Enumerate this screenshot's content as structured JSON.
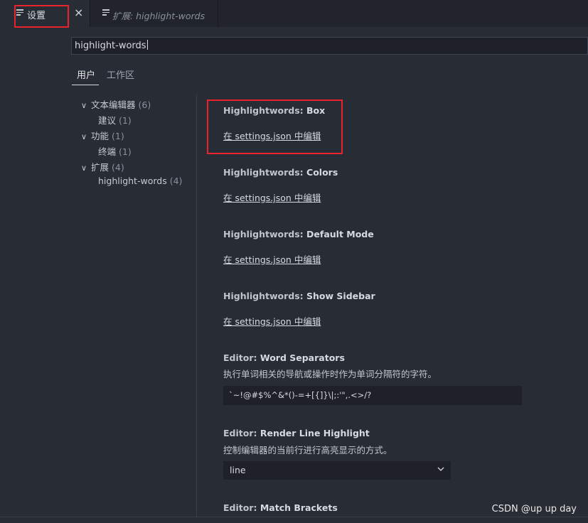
{
  "tabs": [
    {
      "label": "设置",
      "close": "×"
    },
    {
      "label": "扩展: highlight-words"
    }
  ],
  "search": {
    "value": "highlight-words"
  },
  "scopes": {
    "user": "用户",
    "workspace": "工作区"
  },
  "toc": [
    {
      "label": "文本编辑器",
      "count": "(6)",
      "chevron": "∨"
    },
    {
      "label": "建议",
      "count": "(1)"
    },
    {
      "label": "功能",
      "count": "(1)",
      "chevron": "∨"
    },
    {
      "label": "终端",
      "count": "(1)"
    },
    {
      "label": "扩展",
      "count": "(4)",
      "chevron": "∨"
    },
    {
      "label": "highlight-words",
      "count": "(4)"
    }
  ],
  "settings": [
    {
      "category": "Highlightwords: ",
      "name": "Box",
      "link": "在 settings.json 中编辑"
    },
    {
      "category": "Highlightwords: ",
      "name": "Colors",
      "link": "在 settings.json 中编辑"
    },
    {
      "category": "Highlightwords: ",
      "name": "Default Mode",
      "link": "在 settings.json 中编辑"
    },
    {
      "category": "Highlightwords: ",
      "name": "Show Sidebar",
      "link": "在 settings.json 中编辑"
    },
    {
      "category": "Editor: ",
      "name": "Word Separators",
      "description": "执行单词相关的导航或操作时作为单词分隔符的字符。",
      "value": "`~!@#$%^&*()-=+[{]}\\|;:'\",.<>/?"
    },
    {
      "category": "Editor: ",
      "name": "Render Line Highlight",
      "description": "控制编辑器的当前行进行高亮显示的方式。",
      "value": "line"
    },
    {
      "category": "Editor: ",
      "name": "Match Brackets"
    }
  ],
  "watermark": "CSDN @up up day",
  "colors": {
    "highlight_box": "#e8232b",
    "background": "#282c34"
  }
}
